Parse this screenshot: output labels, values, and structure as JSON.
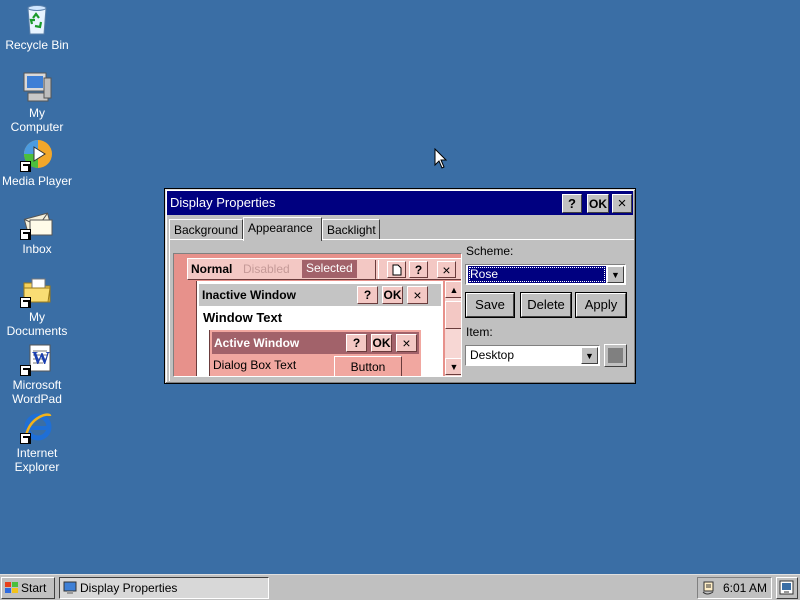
{
  "desktop": {
    "background_color": "#3a6ea5",
    "icons": [
      {
        "label": "Recycle Bin",
        "icon": "recycle-bin-icon"
      },
      {
        "label": "My\nComputer",
        "icon": "computer-icon"
      },
      {
        "label": "Media Player",
        "icon": "media-player-icon"
      },
      {
        "label": "Inbox",
        "icon": "inbox-icon"
      },
      {
        "label": "My\nDocuments",
        "icon": "folder-icon"
      },
      {
        "label": "Microsoft\nWordPad",
        "icon": "wordpad-icon"
      },
      {
        "label": "Internet\nExplorer",
        "icon": "internet-explorer-icon"
      }
    ]
  },
  "window": {
    "title": "Display Properties",
    "help_label": "?",
    "ok_label": "OK",
    "close_label": "×",
    "tabs": [
      {
        "label": "Background",
        "active": false
      },
      {
        "label": "Appearance",
        "active": true
      },
      {
        "label": "Backlight",
        "active": false
      }
    ]
  },
  "preview": {
    "menu_normal": "Normal",
    "menu_disabled": "Disabled",
    "menu_selected": "Selected",
    "inactive_title": "Inactive Window",
    "window_text": "Window Text",
    "active_title": "Active Window",
    "dialog_text": "Dialog Box Text",
    "button_label": "Button",
    "help_label": "?",
    "ok_label": "OK",
    "close_label": "×",
    "colors": {
      "background": "#e7918b",
      "menu": "#f3c8c4",
      "inactive_title": "#c4c4c4",
      "active_title": "#a2626a",
      "dialog": "#f1a7a0"
    }
  },
  "scheme": {
    "label": "Scheme:",
    "value": "Rose",
    "save_label": "Save",
    "delete_label": "Delete",
    "apply_label": "Apply"
  },
  "item": {
    "label": "Item:",
    "value": "Desktop",
    "color": "#808080"
  },
  "taskbar": {
    "start_label": "Start",
    "task_label": "Display Properties",
    "clock": "6:01 AM"
  }
}
